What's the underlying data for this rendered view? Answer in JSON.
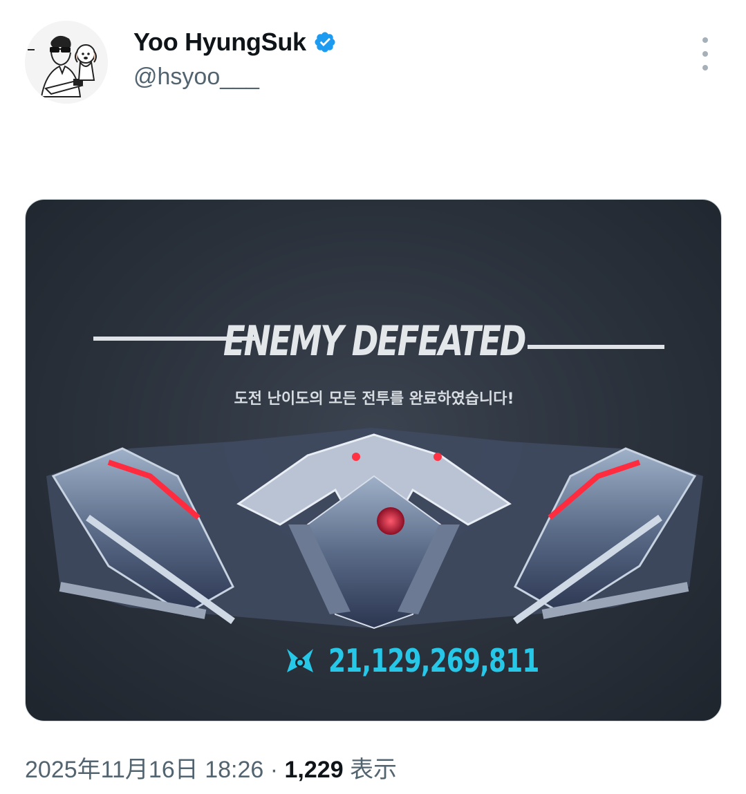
{
  "author": {
    "display_name": "Yoo HyungSuk",
    "handle": "@hsyoo___",
    "verified": true
  },
  "media": {
    "title": "ENEMY DEFEATED",
    "subtitle": "도전 난이도의 모든 전투를 완료하였습니다!",
    "score": "21,129,269,811"
  },
  "meta": {
    "timestamp": "2025年11月16日 18:26",
    "separator": "·",
    "views_count": "1,229",
    "views_label": "表示"
  },
  "colors": {
    "verified_badge": "#1d9bf0",
    "score_cyan": "#27c7e8",
    "secondary_text": "#536471"
  },
  "icons": [
    "verified-badge-icon",
    "more-options-icon",
    "score-emblem-icon"
  ]
}
